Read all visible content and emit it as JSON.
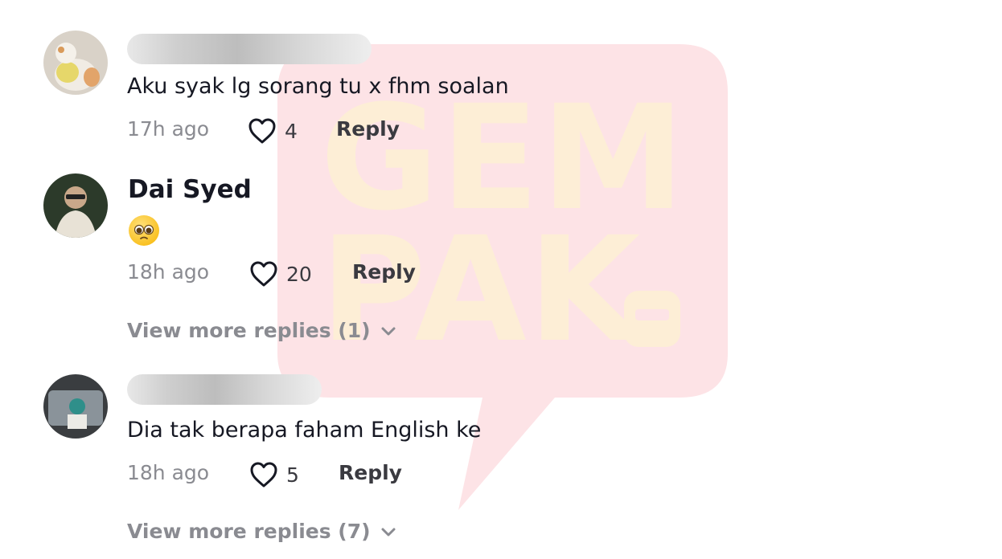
{
  "watermark": {
    "line1": "GEM",
    "line2": "PAK"
  },
  "comments": [
    {
      "text": "Aku syak lg sorang tu x fhm soalan",
      "time": "17h ago",
      "likes": "4",
      "reply": "Reply"
    },
    {
      "username": "Dai Syed",
      "emoji": "pleading-face",
      "time": "18h ago",
      "likes": "20",
      "reply": "Reply",
      "more_replies": "View more replies (1)"
    },
    {
      "text": "Dia tak berapa faham English ke",
      "time": "18h ago",
      "likes": "5",
      "reply": "Reply",
      "more_replies": "View more replies (7)"
    }
  ],
  "colors": {
    "text": "#161823",
    "muted": "#8a8b91",
    "watermark_bubble": "#fde3e6",
    "watermark_text": "#fdeed6"
  }
}
